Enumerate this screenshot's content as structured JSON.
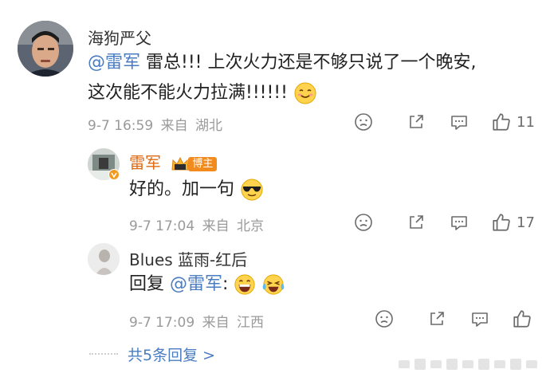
{
  "comments": [
    {
      "username": "海狗严父",
      "mention": "@雷军",
      "text_line1": " 雷总!!! 上次火力还是不够只说了一个晚安,",
      "text_line2": "这次能不能火力拉满!!!!!!",
      "date": "9-7 16:59",
      "from": "来自",
      "location": "湖北",
      "likes": "11"
    },
    {
      "username": "雷军",
      "badge_label": "博主",
      "text": "好的。加一句",
      "date": "9-7 17:04",
      "from": "来自",
      "location": "北京",
      "likes": "17"
    },
    {
      "username": "Blues 蓝雨-红后",
      "reply_prefix": "回复",
      "mention": "@雷军",
      "colon": ":",
      "date": "9-7 17:09",
      "from": "来自",
      "location": "江西"
    }
  ],
  "more_replies": "共5条回复 >",
  "colors": {
    "mention": "#4a7cc2",
    "meta": "#9a9a9a",
    "badge": "#f28b1e"
  },
  "icons": [
    "frown-icon",
    "share-icon",
    "comment-icon",
    "like-icon",
    "smile-emoji",
    "sunglasses-emoji",
    "grin-emoji",
    "laugh-cry-emoji"
  ]
}
